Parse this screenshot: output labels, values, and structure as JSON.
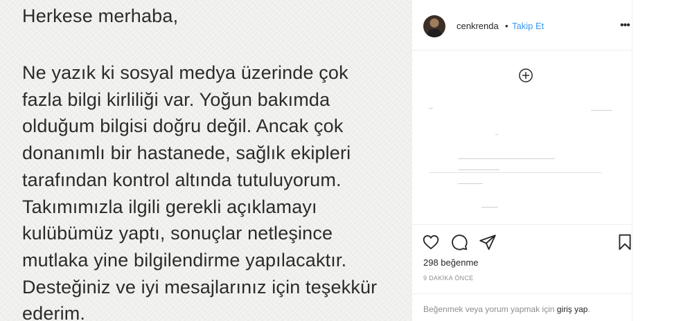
{
  "post": {
    "greeting": "Herkese merhaba,",
    "body_lines": [
      "Ne yazık ki sosyal medya üzerinde çok",
      "fazla bilgi kirliliği var. Yoğun bakımda",
      "olduğum bilgisi doğru değil. Ancak çok",
      "donanımlı bir hastanede, sağlık ekipleri",
      "tarafından kontrol altında tutuluyorum.",
      "Takımımızla ilgili gerekli açıklamayı",
      "kulübümüz yaptı, sonuçlar netleşince",
      "mutlaka yine bilgilendirme yapılacaktır.",
      "Desteğiniz ve iyi mesajlarınız için teşekkür",
      "ederim."
    ]
  },
  "header": {
    "username": "cenkrenda",
    "separator": "•",
    "follow_label": "Takip Et",
    "more_icon": "more-options-icon"
  },
  "comments": {
    "load_more_icon": "plus-circle-icon"
  },
  "actions": {
    "icons": [
      "heart-icon",
      "comment-icon",
      "share-icon",
      "bookmark-icon"
    ]
  },
  "stats": {
    "likes": "298 beğenme",
    "timestamp": "9 DAKİKA ÖNCE"
  },
  "footer": {
    "prefix": "Beğenmek veya yorum yapmak için ",
    "link": "giriş yap",
    "suffix": "."
  },
  "colors": {
    "link_blue": "#3897f0",
    "text_dark": "#262626",
    "text_muted": "#8e8e8e",
    "note_bg": "#f3f3f1"
  }
}
